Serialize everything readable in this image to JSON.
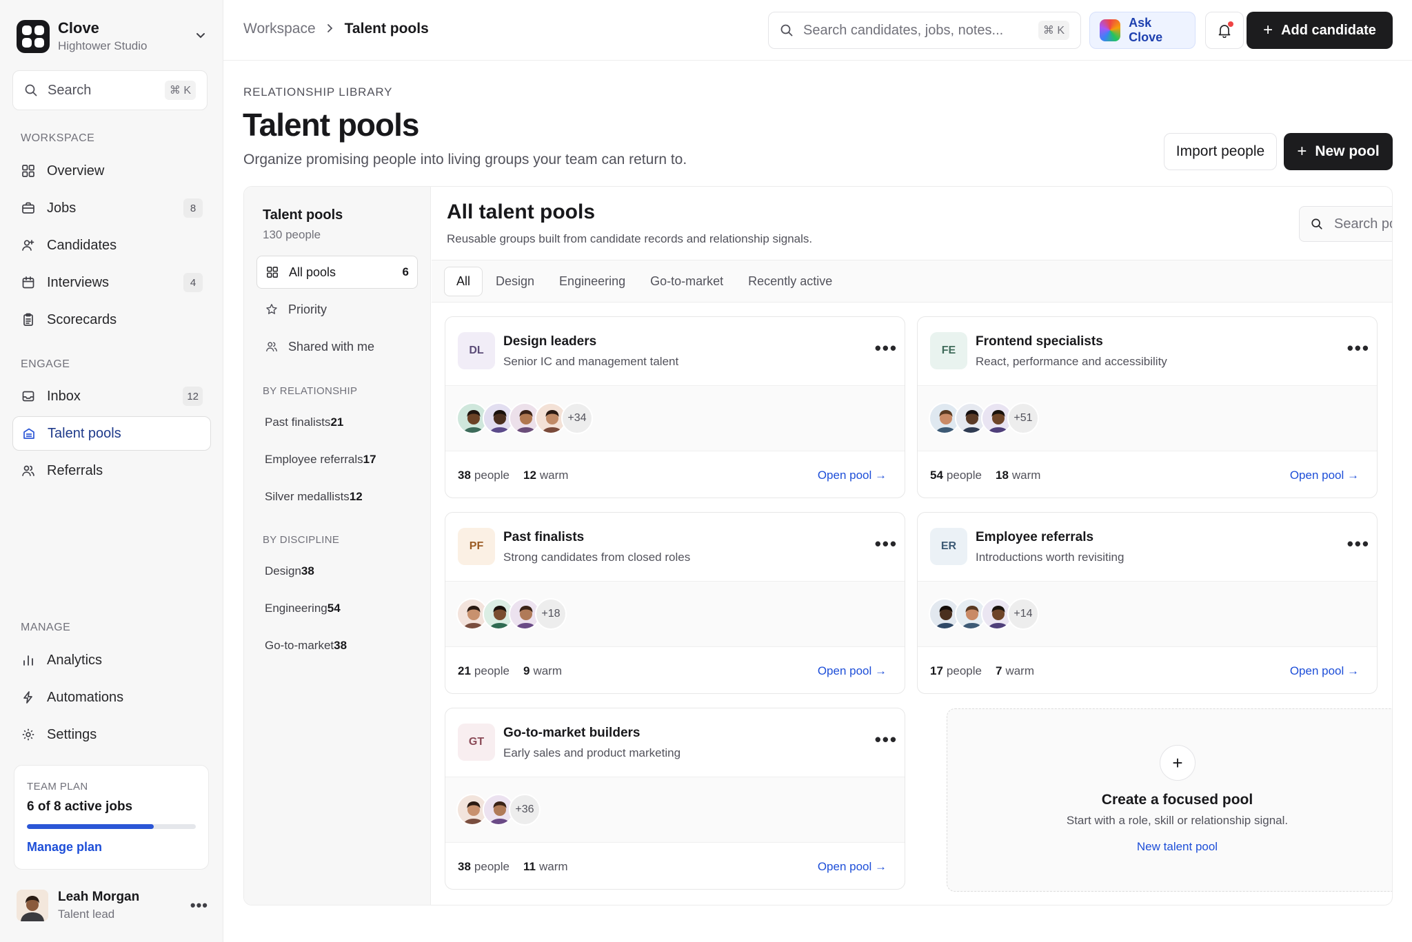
{
  "brand": {
    "name": "Clove",
    "workspace": "Hightower Studio"
  },
  "sidebar": {
    "search_placeholder": "Search",
    "search_shortcut": "⌘ K",
    "sections": {
      "workspace": "WORKSPACE",
      "engage": "ENGAGE",
      "manage": "MANAGE"
    },
    "workspace_items": [
      {
        "label": "Overview",
        "icon": "grid-icon"
      },
      {
        "label": "Jobs",
        "icon": "briefcase-icon",
        "count": "8"
      },
      {
        "label": "Candidates",
        "icon": "user-plus-icon"
      },
      {
        "label": "Interviews",
        "icon": "calendar-icon",
        "count": "4"
      },
      {
        "label": "Scorecards",
        "icon": "clipboard-icon"
      }
    ],
    "engage_items": [
      {
        "label": "Inbox",
        "icon": "inbox-icon",
        "count": "12"
      },
      {
        "label": "Talent pools",
        "icon": "layers-icon",
        "active": true
      },
      {
        "label": "Referrals",
        "icon": "users-icon"
      }
    ],
    "manage_items": [
      {
        "label": "Analytics",
        "icon": "bar-chart-icon"
      },
      {
        "label": "Automations",
        "icon": "lightning-icon"
      },
      {
        "label": "Settings",
        "icon": "gear-icon"
      }
    ],
    "plan": {
      "label": "TEAM PLAN",
      "value": "6 of 8 active jobs",
      "progress": 0.75,
      "link": "Manage plan"
    },
    "user": {
      "name": "Leah Morgan",
      "role": "Talent lead"
    }
  },
  "topbar": {
    "breadcrumb": [
      "Workspace",
      "Talent pools"
    ],
    "search_placeholder": "Search candidates, jobs, notes...",
    "search_shortcut": "⌘ K",
    "ask_label": "Ask Clove",
    "add_label": "Add candidate"
  },
  "header": {
    "eyebrow": "RELATIONSHIP LIBRARY",
    "title": "Talent pools",
    "subtitle": "Organize promising people into living groups your team can return to.",
    "import_label": "Import people",
    "new_label": "New pool"
  },
  "subnav": {
    "title": "Talent pools",
    "subtitle": "130 people",
    "items": [
      {
        "label": "All pools",
        "count": "6",
        "icon": "grid-icon",
        "active": true
      },
      {
        "label": "Priority",
        "icon": "star-icon"
      },
      {
        "label": "Shared with me",
        "icon": "users-icon"
      }
    ],
    "relationship_label": "BY RELATIONSHIP",
    "relationship": [
      {
        "label": "Past finalists",
        "count": "21"
      },
      {
        "label": "Employee referrals",
        "count": "17"
      },
      {
        "label": "Silver medallists",
        "count": "12"
      }
    ],
    "discipline_label": "BY DISCIPLINE",
    "discipline": [
      {
        "label": "Design",
        "count": "38"
      },
      {
        "label": "Engineering",
        "count": "54"
      },
      {
        "label": "Go-to-market",
        "count": "38"
      }
    ]
  },
  "main": {
    "title": "All talent pools",
    "subtitle": "Reusable groups built from candidate records and relationship signals.",
    "search_placeholder": "Search pools",
    "tabs": [
      "All",
      "Design",
      "Engineering",
      "Go-to-market",
      "Recently active"
    ],
    "people_word": "people",
    "warm_word": "warm",
    "open_label": "Open pool →",
    "pools": [
      {
        "initials": "DL",
        "name": "Design leaders",
        "desc": "Senior IC and management talent",
        "people": "38",
        "warm": "12",
        "more": "+34",
        "badge_bg": "#f1edf7",
        "badge_fg": "#5b4b77"
      },
      {
        "initials": "FE",
        "name": "Frontend specialists",
        "desc": "React, performance and accessibility",
        "people": "54",
        "warm": "18",
        "more": "+51",
        "badge_bg": "#e9f3ef",
        "badge_fg": "#3f6b5a"
      },
      {
        "initials": "PF",
        "name": "Past finalists",
        "desc": "Strong candidates from closed roles",
        "people": "21",
        "warm": "9",
        "more": "+18",
        "badge_bg": "#fbf0e4",
        "badge_fg": "#9a5a22"
      },
      {
        "initials": "ER",
        "name": "Employee referrals",
        "desc": "Introductions worth revisiting",
        "people": "17",
        "warm": "7",
        "more": "+14",
        "badge_bg": "#ebf1f6",
        "badge_fg": "#3d5a75"
      },
      {
        "initials": "GT",
        "name": "Go-to-market builders",
        "desc": "Early sales and product marketing",
        "people": "38",
        "warm": "11",
        "more": "+36",
        "badge_bg": "#f8eef0",
        "badge_fg": "#8a4a57"
      }
    ],
    "create": {
      "title": "Create a focused pool",
      "subtitle": "Start with a role, skill or relationship signal.",
      "link": "New talent pool"
    }
  }
}
